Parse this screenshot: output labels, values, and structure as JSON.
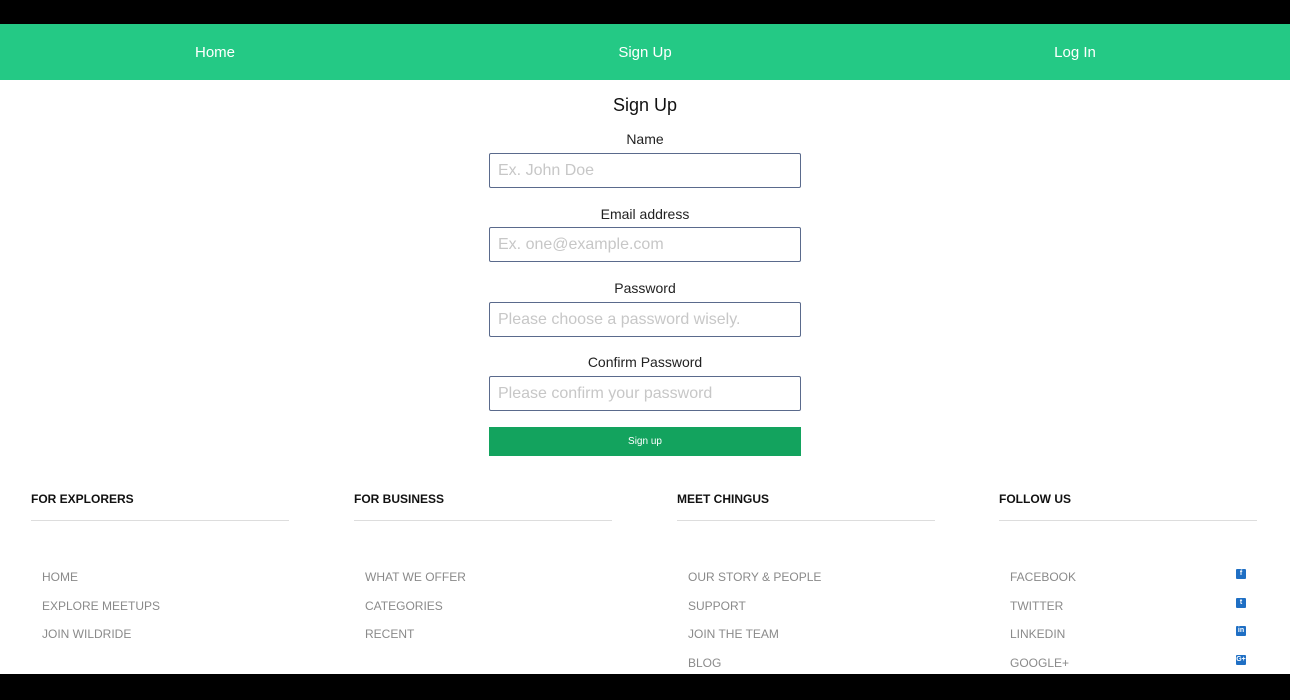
{
  "nav": {
    "items": [
      {
        "label": "Home"
      },
      {
        "label": "Sign Up"
      },
      {
        "label": "Log In"
      }
    ]
  },
  "form": {
    "title": "Sign Up",
    "fields": [
      {
        "label": "Name",
        "placeholder": "Ex. John Doe",
        "value": ""
      },
      {
        "label": "Email address",
        "placeholder": "Ex. one@example.com",
        "value": ""
      },
      {
        "label": "Password",
        "placeholder": "Please choose a password wisely.",
        "value": ""
      },
      {
        "label": "Confirm Password",
        "placeholder": "Please confirm your password",
        "value": ""
      }
    ],
    "submit_label": "Sign up"
  },
  "footer": {
    "columns": [
      {
        "heading": "FOR EXPLORERS",
        "links": [
          "HOME",
          "EXPLORE MEETUPS",
          "JOIN WILDRIDE"
        ]
      },
      {
        "heading": "FOR BUSINESS",
        "links": [
          "WHAT WE OFFER",
          "CATEGORIES",
          "RECENT"
        ]
      },
      {
        "heading": "MEET CHINGUS",
        "links": [
          "OUR STORY & PEOPLE",
          "SUPPORT",
          "JOIN THE TEAM",
          "BLOG"
        ]
      },
      {
        "heading": "FOLLOW US",
        "links": [
          "FACEBOOK",
          "TWITTER",
          "LINKEDIN",
          "GOOGLE+"
        ]
      }
    ],
    "social_icons": [
      {
        "name": "facebook-icon",
        "glyph": "f"
      },
      {
        "name": "twitter-icon",
        "glyph": "t"
      },
      {
        "name": "linkedin-icon",
        "glyph": "in"
      },
      {
        "name": "google-plus-icon",
        "glyph": "G+"
      }
    ]
  },
  "colors": {
    "nav_bg": "#24c985",
    "button_bg": "#13a35e",
    "social_icon": "#1f6fc4"
  }
}
